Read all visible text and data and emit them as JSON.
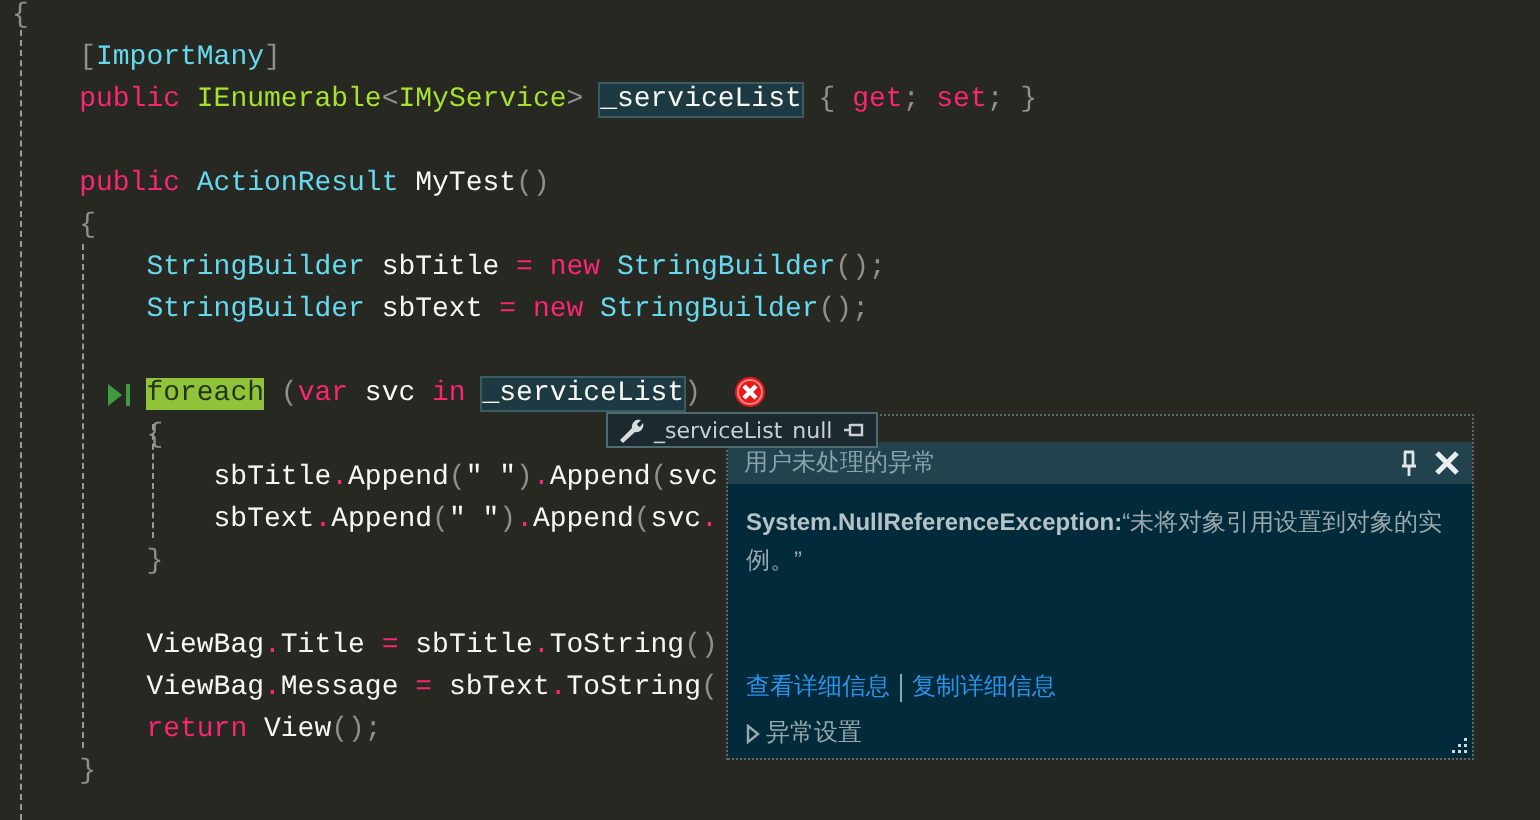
{
  "editor": {
    "lines": [
      {
        "current": false,
        "error": false,
        "tokens": [
          {
            "kind": "punct",
            "t": "{"
          }
        ],
        "children": [
          {
            "current": false,
            "error": false,
            "tokens": [
              {
                "kind": "punct",
                "t": "["
              },
              {
                "kind": "type",
                "t": "ImportMany"
              },
              {
                "kind": "punct",
                "t": "]"
              }
            ]
          },
          {
            "current": false,
            "error": false,
            "tokens": [
              {
                "kind": "kw",
                "t": "public "
              },
              {
                "kind": "iface",
                "t": "IEnumerable"
              },
              {
                "kind": "punct",
                "t": "<"
              },
              {
                "kind": "iface",
                "t": "IMyService"
              },
              {
                "kind": "punct",
                "t": "> "
              },
              {
                "kind": "ref",
                "t": "_serviceList"
              },
              {
                "kind": "punct",
                "t": " { "
              },
              {
                "kind": "kw",
                "t": "get"
              },
              {
                "kind": "punct",
                "t": "; "
              },
              {
                "kind": "kw",
                "t": "set"
              },
              {
                "kind": "punct",
                "t": "; }"
              }
            ]
          },
          {
            "current": false,
            "error": false
          },
          {
            "current": false,
            "error": false,
            "tokens": [
              {
                "kind": "kw",
                "t": "public "
              },
              {
                "kind": "type",
                "t": "ActionResult "
              },
              {
                "kind": "id",
                "t": "MyTest"
              },
              {
                "kind": "punct",
                "t": "()"
              }
            ]
          },
          {
            "current": false,
            "error": false,
            "tokens": [
              {
                "kind": "punct",
                "t": "{"
              }
            ],
            "children": [
              {
                "current": false,
                "error": false,
                "tokens": [
                  {
                    "kind": "type",
                    "t": "StringBuilder "
                  },
                  {
                    "kind": "id",
                    "t": "sbTitle "
                  },
                  {
                    "kind": "op",
                    "t": "= "
                  },
                  {
                    "kind": "kw",
                    "t": "new "
                  },
                  {
                    "kind": "type",
                    "t": "StringBuilder"
                  },
                  {
                    "kind": "punct",
                    "t": "();"
                  }
                ]
              },
              {
                "current": false,
                "error": false,
                "tokens": [
                  {
                    "kind": "type",
                    "t": "StringBuilder "
                  },
                  {
                    "kind": "id",
                    "t": "sbText "
                  },
                  {
                    "kind": "op",
                    "t": "= "
                  },
                  {
                    "kind": "kw",
                    "t": "new "
                  },
                  {
                    "kind": "type",
                    "t": "StringBuilder"
                  },
                  {
                    "kind": "punct",
                    "t": "();"
                  }
                ]
              },
              {
                "current": false,
                "error": false
              },
              {
                "current": true,
                "error": true,
                "tokens": [
                  {
                    "kind": "current",
                    "t": "foreach"
                  },
                  {
                    "kind": "punct",
                    "t": " ("
                  },
                  {
                    "kind": "kw",
                    "t": "var "
                  },
                  {
                    "kind": "id",
                    "t": "svc "
                  },
                  {
                    "kind": "kw",
                    "t": "in "
                  },
                  {
                    "kind": "ref",
                    "t": "_serviceList"
                  },
                  {
                    "kind": "punct",
                    "t": ")"
                  }
                ]
              },
              {
                "current": false,
                "error": false,
                "tokens": [
                  {
                    "kind": "punct",
                    "t": "{"
                  }
                ],
                "children": [
                  {
                    "current": false,
                    "error": false,
                    "tokens": [
                      {
                        "kind": "id",
                        "t": "sbTitle"
                      },
                      {
                        "kind": "op",
                        "t": "."
                      },
                      {
                        "kind": "id",
                        "t": "Append"
                      },
                      {
                        "kind": "punct",
                        "t": "("
                      },
                      {
                        "kind": "id",
                        "t": "\" \""
                      },
                      {
                        "kind": "punct",
                        "t": ")"
                      },
                      {
                        "kind": "op",
                        "t": "."
                      },
                      {
                        "kind": "id",
                        "t": "Append"
                      },
                      {
                        "kind": "punct",
                        "t": "("
                      },
                      {
                        "kind": "id",
                        "t": "svc"
                      }
                    ]
                  },
                  {
                    "current": false,
                    "error": false,
                    "tokens": [
                      {
                        "kind": "id",
                        "t": "sbText"
                      },
                      {
                        "kind": "op",
                        "t": "."
                      },
                      {
                        "kind": "id",
                        "t": "Append"
                      },
                      {
                        "kind": "punct",
                        "t": "("
                      },
                      {
                        "kind": "id",
                        "t": "\" \""
                      },
                      {
                        "kind": "punct",
                        "t": ")"
                      },
                      {
                        "kind": "op",
                        "t": "."
                      },
                      {
                        "kind": "id",
                        "t": "Append"
                      },
                      {
                        "kind": "punct",
                        "t": "("
                      },
                      {
                        "kind": "id",
                        "t": "svc"
                      },
                      {
                        "kind": "op",
                        "t": "."
                      }
                    ]
                  }
                ]
              },
              {
                "current": false,
                "error": false,
                "tokens": [
                  {
                    "kind": "punct",
                    "t": "}"
                  }
                ]
              },
              {
                "current": false,
                "error": false
              },
              {
                "current": false,
                "error": false,
                "tokens": [
                  {
                    "kind": "id",
                    "t": "ViewBag"
                  },
                  {
                    "kind": "op",
                    "t": "."
                  },
                  {
                    "kind": "id",
                    "t": "Title "
                  },
                  {
                    "kind": "op",
                    "t": "= "
                  },
                  {
                    "kind": "id",
                    "t": "sbTitle"
                  },
                  {
                    "kind": "op",
                    "t": "."
                  },
                  {
                    "kind": "id",
                    "t": "ToString"
                  },
                  {
                    "kind": "punct",
                    "t": "()"
                  }
                ]
              },
              {
                "current": false,
                "error": false,
                "tokens": [
                  {
                    "kind": "id",
                    "t": "ViewBag"
                  },
                  {
                    "kind": "op",
                    "t": "."
                  },
                  {
                    "kind": "id",
                    "t": "Message "
                  },
                  {
                    "kind": "op",
                    "t": "= "
                  },
                  {
                    "kind": "id",
                    "t": "sbText"
                  },
                  {
                    "kind": "op",
                    "t": "."
                  },
                  {
                    "kind": "id",
                    "t": "ToString"
                  },
                  {
                    "kind": "punct",
                    "t": "("
                  }
                ]
              },
              {
                "current": false,
                "error": false,
                "tokens": [
                  {
                    "kind": "kw",
                    "t": "return "
                  },
                  {
                    "kind": "id",
                    "t": "View"
                  },
                  {
                    "kind": "punct",
                    "t": "();"
                  }
                ]
              }
            ]
          },
          {
            "current": false,
            "error": false,
            "tokens": [
              {
                "kind": "punct",
                "t": "}"
              }
            ]
          }
        ]
      }
    ]
  },
  "datatip": {
    "name": "_serviceList",
    "value": "null"
  },
  "exception_popup": {
    "title": "用户未处理的异常",
    "message": "**System.NullReferenceException:**“未将对象引用设置到对象的实例。”",
    "links": [
      "查看详细信息",
      "复制详细信息"
    ],
    "settings": {
      "label": "异常设置",
      "expanded": false
    }
  }
}
